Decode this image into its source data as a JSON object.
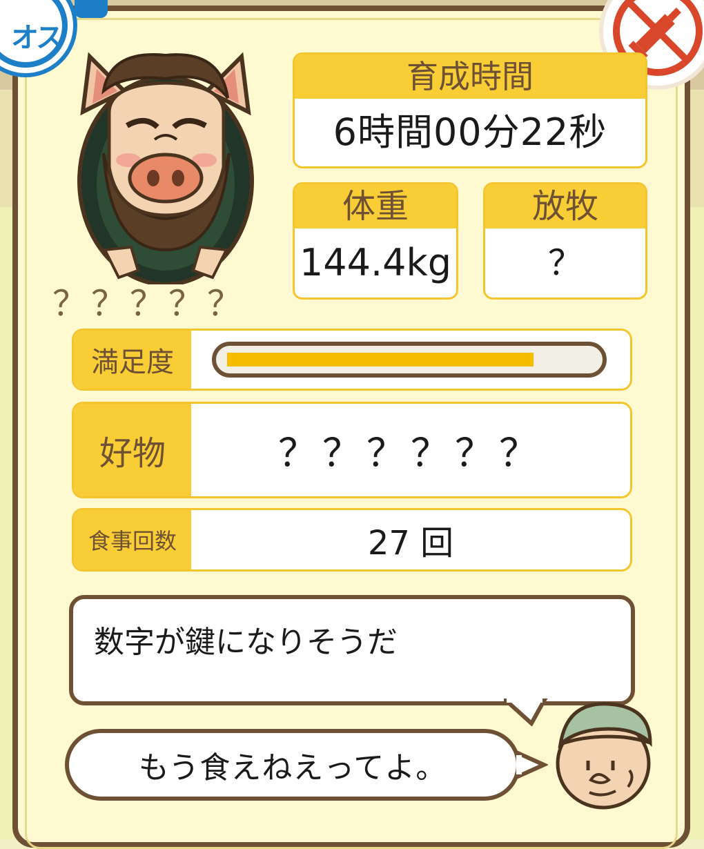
{
  "badges": {
    "gender_label": "オス",
    "gender_icon": "male-badge-icon",
    "right_icon": "no-syringe-icon"
  },
  "pig": {
    "icon": "pig-character-icon",
    "name": "？？？？？"
  },
  "stats": {
    "time_label": "育成時間",
    "time_value": "6時間00分22秒",
    "weight_label": "体重",
    "weight_value": "144.4kg",
    "graze_label": "放牧",
    "graze_value": "？"
  },
  "satisfaction": {
    "label": "満足度",
    "level": 0.84
  },
  "favorite": {
    "label": "好物",
    "value": "？？？？？？"
  },
  "meals": {
    "label": "食事回数",
    "value": "27 回"
  },
  "hint": {
    "text": "数字が鍵になりそうだ"
  },
  "speech": {
    "text": "もう食えねえってよ。",
    "speaker_icon": "farmer-face-icon"
  },
  "colors": {
    "frame": "#6e5134",
    "label_yellow": "#f9cd35",
    "bar_fill": "#f6bc00",
    "badge_blue": "#1d7fc7",
    "badge_red": "#d9472b"
  }
}
